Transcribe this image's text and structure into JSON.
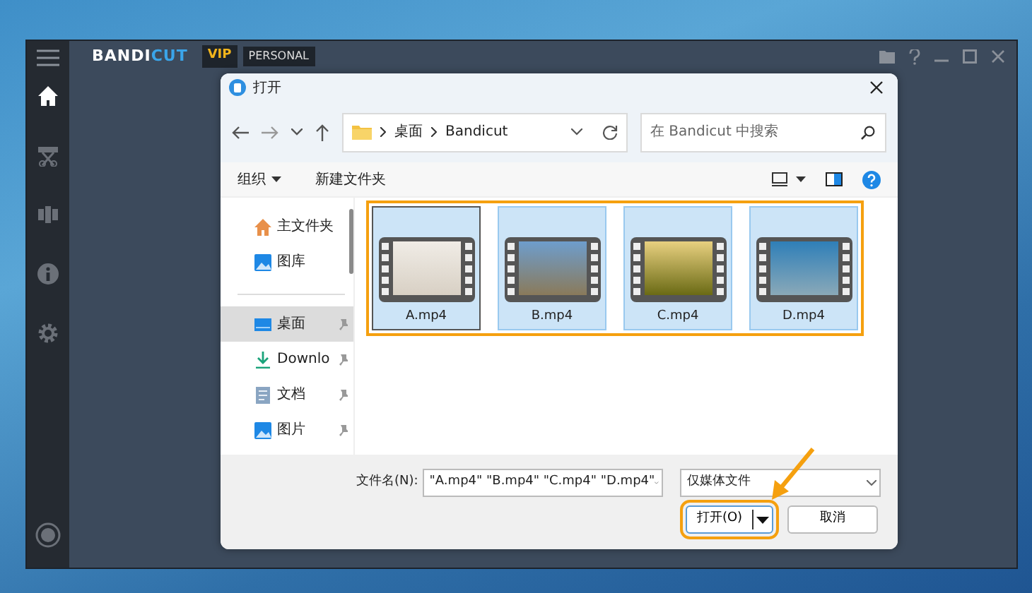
{
  "app": {
    "logo": {
      "primary": "BANDI",
      "accent": "CUT"
    },
    "badges": [
      {
        "label": "VIP",
        "kind": "vip"
      },
      {
        "label": "PERSONAL",
        "kind": "plain"
      }
    ]
  },
  "sidebar": {
    "items": [
      {
        "kind": "home",
        "selected": true
      },
      {
        "kind": "cut",
        "selected": false
      },
      {
        "kind": "join",
        "selected": false
      },
      {
        "kind": "info",
        "selected": false
      },
      {
        "kind": "settings",
        "selected": false
      }
    ]
  },
  "dialog": {
    "title": "打开",
    "breadcrumb": [
      "桌面",
      "Bandicut"
    ],
    "search": {
      "placeholder": "在 Bandicut 中搜索"
    },
    "toolbar": [
      {
        "label": "组织",
        "has_caret": true
      },
      {
        "label": "新建文件夹",
        "has_caret": false
      }
    ],
    "nav_pane": [
      {
        "label": "主文件夹",
        "kind": "home",
        "pinned": false,
        "selected": false
      },
      {
        "label": "图库",
        "kind": "gallery",
        "pinned": false,
        "selected": false
      },
      {
        "label": "桌面",
        "kind": "desktop",
        "pinned": true,
        "selected": true
      },
      {
        "label": "Downlo",
        "kind": "download",
        "pinned": true,
        "selected": false
      },
      {
        "label": "文档",
        "kind": "document",
        "pinned": true,
        "selected": false
      },
      {
        "label": "图片",
        "kind": "gallery",
        "pinned": true,
        "selected": false
      }
    ],
    "files": [
      {
        "name": "A.mp4",
        "selected": true,
        "focused": true
      },
      {
        "name": "B.mp4",
        "selected": true,
        "focused": false
      },
      {
        "name": "C.mp4",
        "selected": true,
        "focused": false
      },
      {
        "name": "D.mp4",
        "selected": true,
        "focused": false
      }
    ],
    "file_name": {
      "label": "文件名(N):",
      "value": "\"A.mp4\" \"B.mp4\" \"C.mp4\" \"D.mp4\""
    },
    "file_type": {
      "value": "仅媒体文件"
    },
    "buttons": [
      {
        "label": "打开(O)",
        "kind": "split",
        "highlighted": true
      },
      {
        "label": "取消",
        "kind": "plain",
        "highlighted": false
      }
    ]
  },
  "annotations": {
    "files_frame": true,
    "arrow": true
  }
}
